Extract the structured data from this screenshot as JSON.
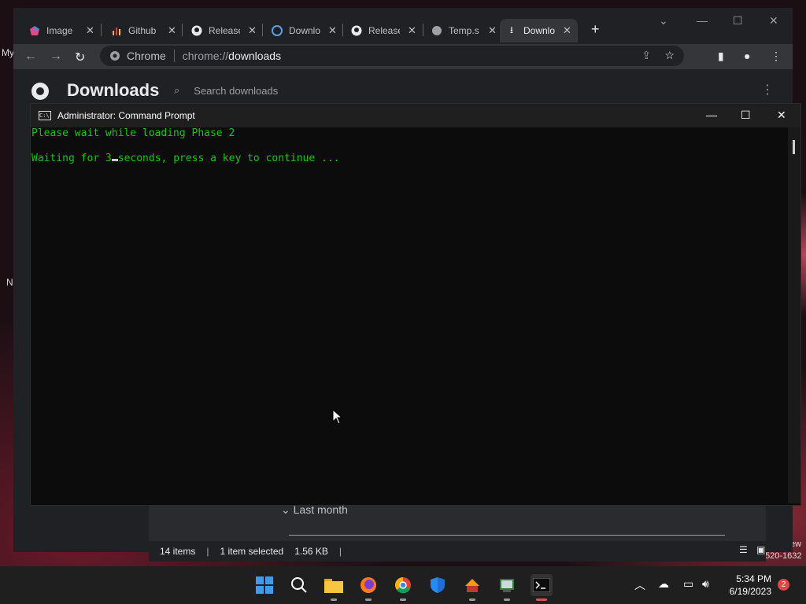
{
  "desktop": {
    "labels": [
      "My",
      "N"
    ],
    "right_labels": [
      "ew",
      "520-1632"
    ]
  },
  "browser": {
    "tabs": [
      {
        "title": "Image"
      },
      {
        "title": "Github"
      },
      {
        "title": "Releases"
      },
      {
        "title": "Download"
      },
      {
        "title": "Releases"
      },
      {
        "title": "Temp.s"
      },
      {
        "title": "Download",
        "active": true
      }
    ],
    "omnibox": {
      "chip": "Chrome",
      "url_scheme": "chrome://",
      "url_path": "downloads"
    },
    "downloads": {
      "title": "Downloads",
      "search_placeholder": "Search downloads",
      "section": "Last month",
      "status": {
        "items": "14 items",
        "selected": "1 item selected",
        "size": "1.56 KB"
      }
    }
  },
  "cmd": {
    "title": "Administrator: Command Prompt",
    "line1": "Please wait while loading Phase 2",
    "line2_before": "Waiting for 3",
    "line2_after": "seconds, press a key to continue ..."
  },
  "taskbar": {
    "time": "5:34 PM",
    "date": "6/19/2023",
    "notifications": "2"
  },
  "colors": {
    "console_text": "#16c60c",
    "chrome_bg": "#202124",
    "toolbar_bg": "#35363a"
  }
}
